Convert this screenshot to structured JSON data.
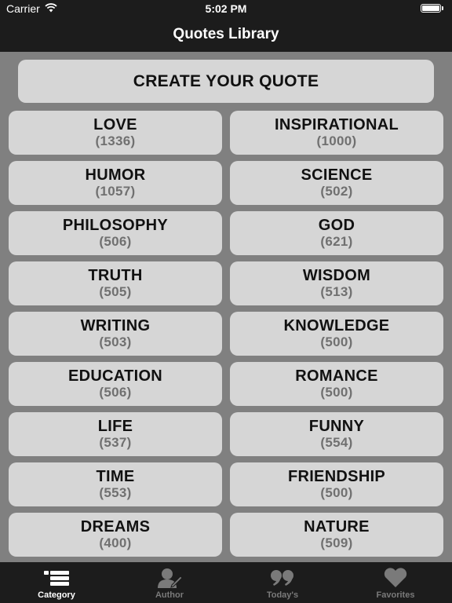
{
  "status_bar": {
    "carrier": "Carrier",
    "time": "5:02 PM",
    "wifi_icon": "wifi-icon",
    "battery_icon": "battery-icon"
  },
  "nav": {
    "title": "Quotes Library"
  },
  "create_button": {
    "label": "CREATE YOUR QUOTE"
  },
  "categories": [
    {
      "name": "LOVE",
      "count": "(1336)"
    },
    {
      "name": "INSPIRATIONAL",
      "count": "(1000)"
    },
    {
      "name": "HUMOR",
      "count": "(1057)"
    },
    {
      "name": "SCIENCE",
      "count": "(502)"
    },
    {
      "name": "PHILOSOPHY",
      "count": "(506)"
    },
    {
      "name": "GOD",
      "count": "(621)"
    },
    {
      "name": "TRUTH",
      "count": "(505)"
    },
    {
      "name": "WISDOM",
      "count": "(513)"
    },
    {
      "name": "WRITING",
      "count": "(503)"
    },
    {
      "name": "KNOWLEDGE",
      "count": "(500)"
    },
    {
      "name": "EDUCATION",
      "count": "(506)"
    },
    {
      "name": "ROMANCE",
      "count": "(500)"
    },
    {
      "name": "LIFE",
      "count": "(537)"
    },
    {
      "name": "FUNNY",
      "count": "(554)"
    },
    {
      "name": "TIME",
      "count": "(553)"
    },
    {
      "name": "FRIENDSHIP",
      "count": "(500)"
    },
    {
      "name": "DREAMS",
      "count": "(400)"
    },
    {
      "name": "NATURE",
      "count": "(509)"
    }
  ],
  "tabs": [
    {
      "label": "Category",
      "icon": "list-icon",
      "active": true
    },
    {
      "label": "Author",
      "icon": "author-icon",
      "active": false
    },
    {
      "label": "Today's",
      "icon": "quote-marks-icon",
      "active": false
    },
    {
      "label": "Favorites",
      "icon": "heart-icon",
      "active": false
    }
  ],
  "colors": {
    "background": "#808080",
    "bar": "#1c1c1c",
    "card": "#d6d6d6",
    "count_text": "#707070",
    "tab_active": "#ffffff",
    "tab_inactive": "#7a7a7a"
  }
}
